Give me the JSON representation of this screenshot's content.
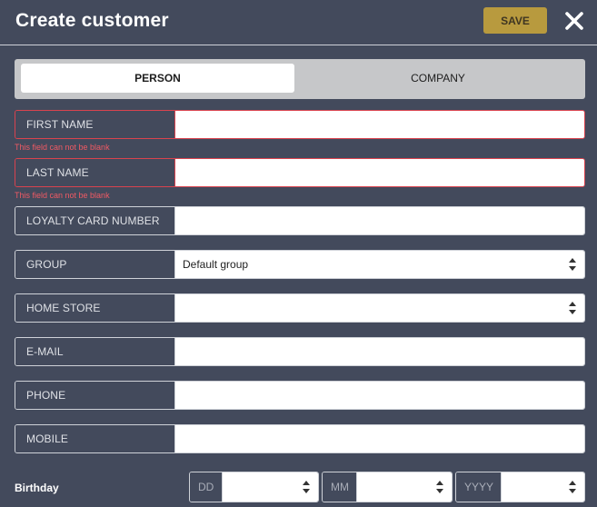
{
  "header": {
    "title": "Create customer",
    "save_label": "SAVE",
    "close_icon": "close-icon"
  },
  "tabs": [
    {
      "label": "PERSON",
      "active": true
    },
    {
      "label": "COMPANY",
      "active": false
    }
  ],
  "fields": {
    "first_name": {
      "label": "FIRST NAME",
      "value": "",
      "error": "This field can not be blank"
    },
    "last_name": {
      "label": "LAST NAME",
      "value": "",
      "error": "This field can not be blank"
    },
    "loyalty_card": {
      "label": "LOYALTY CARD NUMBER",
      "value": ""
    },
    "group": {
      "label": "GROUP",
      "selected": "Default group"
    },
    "home_store": {
      "label": "HOME STORE",
      "selected": ""
    },
    "email": {
      "label": "E-MAIL",
      "value": ""
    },
    "phone": {
      "label": "PHONE",
      "value": ""
    },
    "mobile": {
      "label": "MOBILE",
      "value": ""
    }
  },
  "birthday": {
    "label": "Birthday",
    "day_label": "DD",
    "month_label": "MM",
    "year_label": "YYYY"
  },
  "colors": {
    "background": "#434a5c",
    "accent_save": "#b89a3e",
    "error": "#d9434e"
  }
}
